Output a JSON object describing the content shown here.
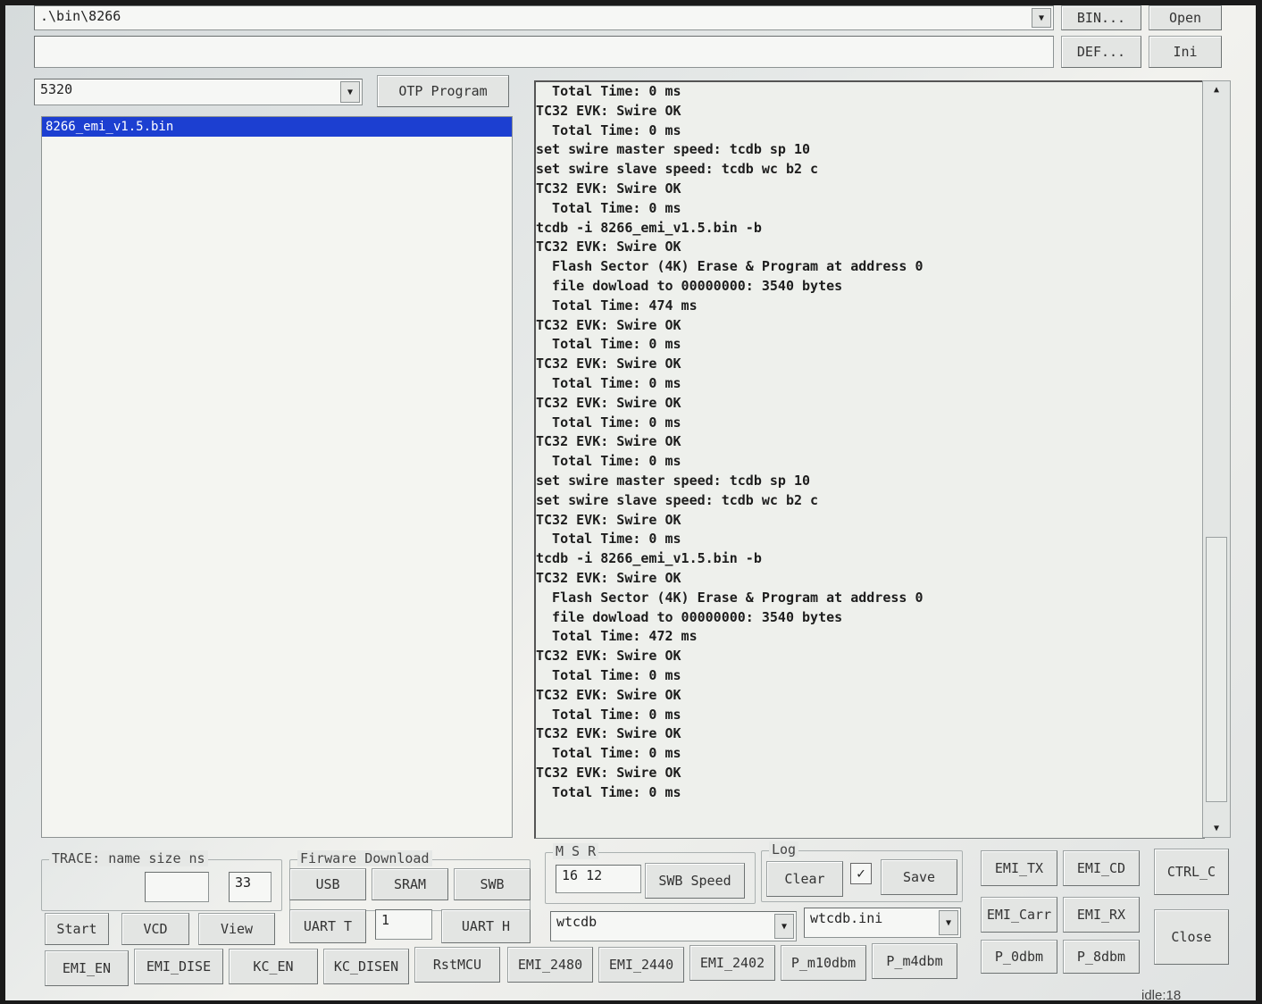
{
  "top": {
    "path_value": ".\\bin\\8266",
    "second_field_value": "",
    "bin_button": "BIN...",
    "open_button": "Open",
    "def_button": "DEF...",
    "ini_button": "Ini"
  },
  "left": {
    "chip_select": "5320",
    "otp_button": "OTP Program",
    "files": [
      "8266_emi_v1.5.bin"
    ]
  },
  "log_lines": [
    "  Total Time: 0 ms",
    "TC32 EVK: Swire OK",
    "  Total Time: 0 ms",
    "set swire master speed: tcdb sp 10",
    "set swire slave speed: tcdb wc b2 c",
    "TC32 EVK: Swire OK",
    "  Total Time: 0 ms",
    "tcdb -i 8266_emi_v1.5.bin -b",
    "TC32 EVK: Swire OK",
    "  Flash Sector (4K) Erase & Program at address 0",
    "  file dowload to 00000000: 3540 bytes",
    "  Total Time: 474 ms",
    "TC32 EVK: Swire OK",
    "  Total Time: 0 ms",
    "TC32 EVK: Swire OK",
    "  Total Time: 0 ms",
    "TC32 EVK: Swire OK",
    "  Total Time: 0 ms",
    "TC32 EVK: Swire OK",
    "  Total Time: 0 ms",
    "set swire master speed: tcdb sp 10",
    "set swire slave speed: tcdb wc b2 c",
    "TC32 EVK: Swire OK",
    "  Total Time: 0 ms",
    "tcdb -i 8266_emi_v1.5.bin -b",
    "TC32 EVK: Swire OK",
    "  Flash Sector (4K) Erase & Program at address 0",
    "  file dowload to 00000000: 3540 bytes",
    "  Total Time: 472 ms",
    "TC32 EVK: Swire OK",
    "  Total Time: 0 ms",
    "TC32 EVK: Swire OK",
    "  Total Time: 0 ms",
    "TC32 EVK: Swire OK",
    "  Total Time: 0 ms",
    "TC32 EVK: Swire OK",
    "  Total Time: 0 ms"
  ],
  "trace": {
    "title": "TRACE: name size ns",
    "name_value": "",
    "size_value": "33",
    "start": "Start",
    "vcd": "VCD",
    "view": "View"
  },
  "firmware": {
    "title": "Firware Download",
    "usb": "USB",
    "sram": "SRAM",
    "swb": "SWB",
    "uart_t": "UART T",
    "uart_value": "1",
    "uart_h": "UART H"
  },
  "msr": {
    "title": "M  S  R",
    "value": "16 12",
    "swb_speed": "SWB Speed",
    "tool_select": "wtcdb"
  },
  "log_group": {
    "title": "Log",
    "clear": "Clear",
    "checkbox_mark": "✓",
    "save": "Save",
    "ini_select": "wtcdb.ini"
  },
  "emi": {
    "tx": "EMI_TX",
    "cd": "EMI_CD",
    "carr": "EMI_Carr",
    "rx": "EMI_RX",
    "p0": "P_0dbm",
    "p8": "P_8dbm",
    "ctrl_c": "CTRL_C",
    "close": "Close"
  },
  "bottom_row": [
    "EMI_EN",
    "EMI_DISE",
    "KC_EN",
    "KC_DISEN",
    "RstMCU",
    "EMI_2480",
    "EMI_2440",
    "EMI_2402",
    "P_m10dbm",
    "P_m4dbm"
  ],
  "status": "idle:18"
}
